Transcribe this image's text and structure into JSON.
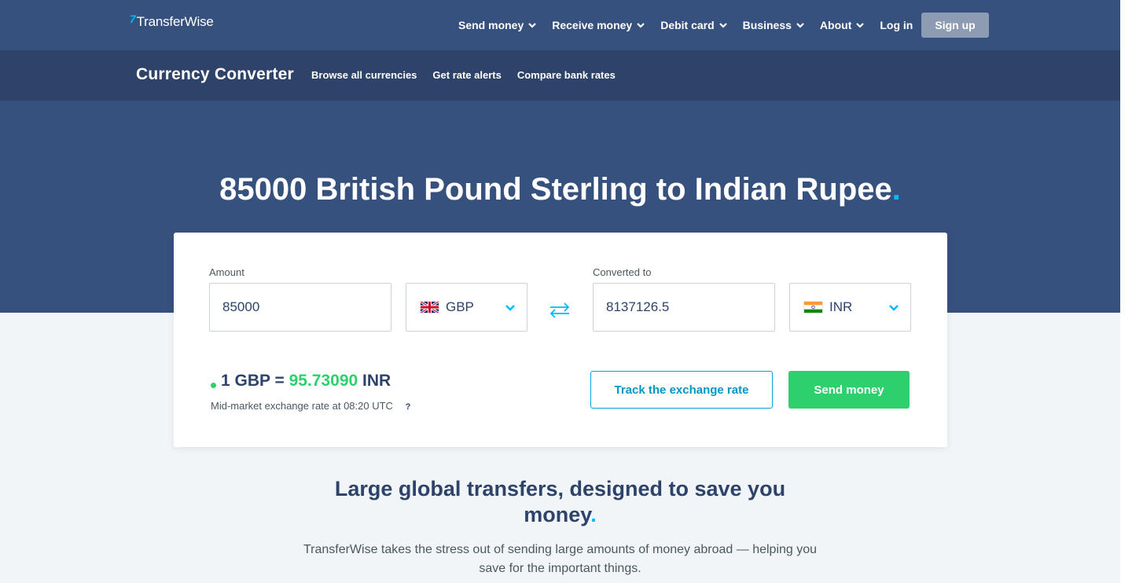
{
  "header": {
    "logo_text": "TransferWise",
    "logo_mark": "7",
    "nav": [
      {
        "label": "Send money",
        "icon": "chevron-down-icon"
      },
      {
        "label": "Receive money",
        "icon": "chevron-down-icon"
      },
      {
        "label": "Debit card",
        "icon": "chevron-down-icon"
      },
      {
        "label": "Business",
        "icon": "chevron-down-icon"
      },
      {
        "label": "About",
        "icon": "chevron-down-icon"
      }
    ],
    "login": "Log in",
    "signup": "Sign up"
  },
  "subnav": {
    "title": "Currency Converter",
    "links": [
      "Browse all currencies",
      "Get rate alerts",
      "Compare bank rates"
    ]
  },
  "hero": {
    "title": "85000 British Pound Sterling to Indian Rupee",
    "title_dot": "."
  },
  "converter": {
    "amount_label": "Amount",
    "amount_value": "85000",
    "from_currency": {
      "code": "GBP",
      "flag": "uk-flag-icon"
    },
    "converted_label": "Converted to",
    "converted_value": "8137126.5",
    "to_currency": {
      "code": "INR",
      "flag": "india-flag-icon"
    },
    "rate_prefix": "1 GBP =",
    "rate_value": "95.73090",
    "rate_suffix": "INR",
    "rate_note": "Mid-market exchange rate at 08:20 UTC",
    "help": "?",
    "track_button": "Track the exchange rate",
    "send_button": "Send money"
  },
  "section": {
    "title": "Large global transfers, designed to save you money",
    "title_dot": ".",
    "body": "TransferWise takes the stress out of sending large amounts of money abroad — helping you save for the important things."
  },
  "colors": {
    "nav_bg": "#37517e",
    "subnav_bg": "#2e4369",
    "accent_blue": "#00b9ff",
    "accent_green": "#2ed06e",
    "text_dark": "#2e4369"
  }
}
